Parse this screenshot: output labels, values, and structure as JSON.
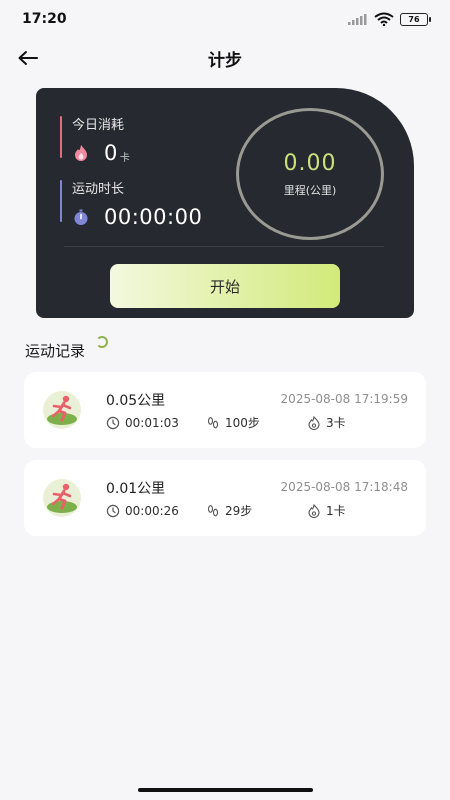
{
  "status_bar": {
    "time": "17:20",
    "battery": "76"
  },
  "header": {
    "title": "计步"
  },
  "stats": {
    "calories_label": "今日消耗",
    "calories_value": "0",
    "calories_unit": "卡",
    "duration_label": "运动时长",
    "duration_value": "00:00:00",
    "distance_value": "0.00",
    "distance_label": "里程(公里)",
    "start_label": "开始"
  },
  "records": {
    "title": "运动记录",
    "items": [
      {
        "distance": "0.05公里",
        "datetime": "2025-08-08 17:19:59",
        "duration": "00:01:03",
        "steps": "100步",
        "calories": "3卡"
      },
      {
        "distance": "0.01公里",
        "datetime": "2025-08-08 17:18:48",
        "duration": "00:00:26",
        "steps": "29步",
        "calories": "1卡"
      }
    ]
  },
  "colors": {
    "card_bg": "#262a30",
    "accent": "#c9e27a",
    "calorie_bar": "#e86a7c",
    "duration_bar": "#7f86d8"
  }
}
